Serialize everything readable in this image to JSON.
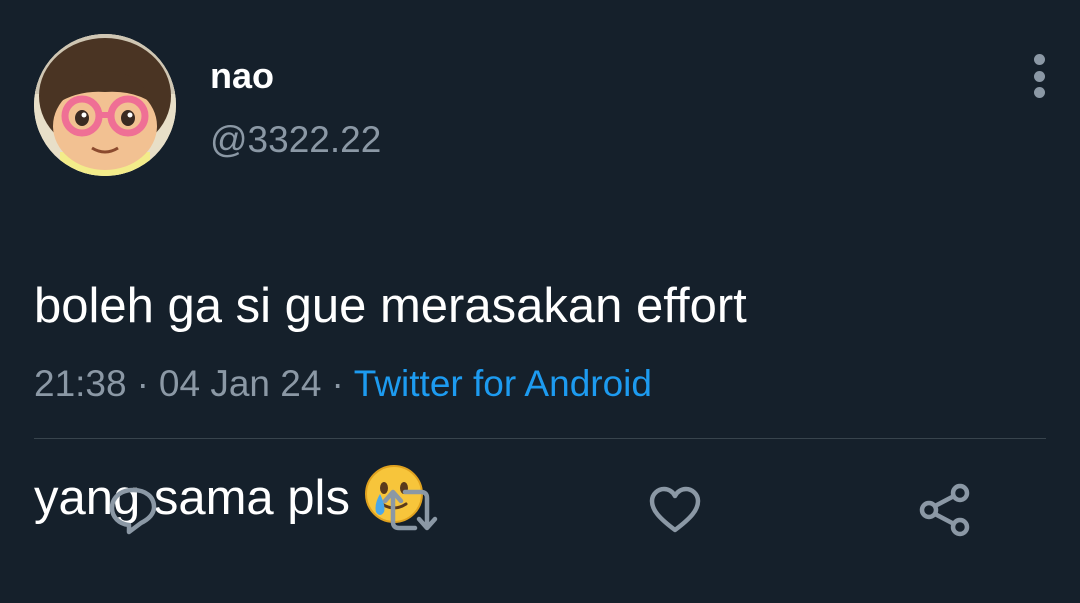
{
  "author": {
    "display_name": "nao",
    "handle": "@3322.22",
    "avatar": "animal-crossing-character-avatar"
  },
  "tweet": {
    "line1": "boleh ga si gue merasakan effort",
    "line2": "yang sama pls",
    "emoji": "face-holding-back-tears"
  },
  "meta": {
    "time": "21:38",
    "sep1": "·",
    "date": "04 Jan 24",
    "sep2": "·",
    "source": "Twitter for Android"
  },
  "actions": {
    "reply_icon": "reply-icon",
    "retweet_icon": "retweet-icon",
    "like_icon": "heart-icon",
    "share_icon": "share-icon",
    "more_icon": "more-vertical-icon"
  },
  "colors": {
    "background": "#15202b",
    "text_primary": "#ffffff",
    "text_secondary": "#8b98a5",
    "link": "#1d9bf0",
    "divider": "#38444d"
  }
}
